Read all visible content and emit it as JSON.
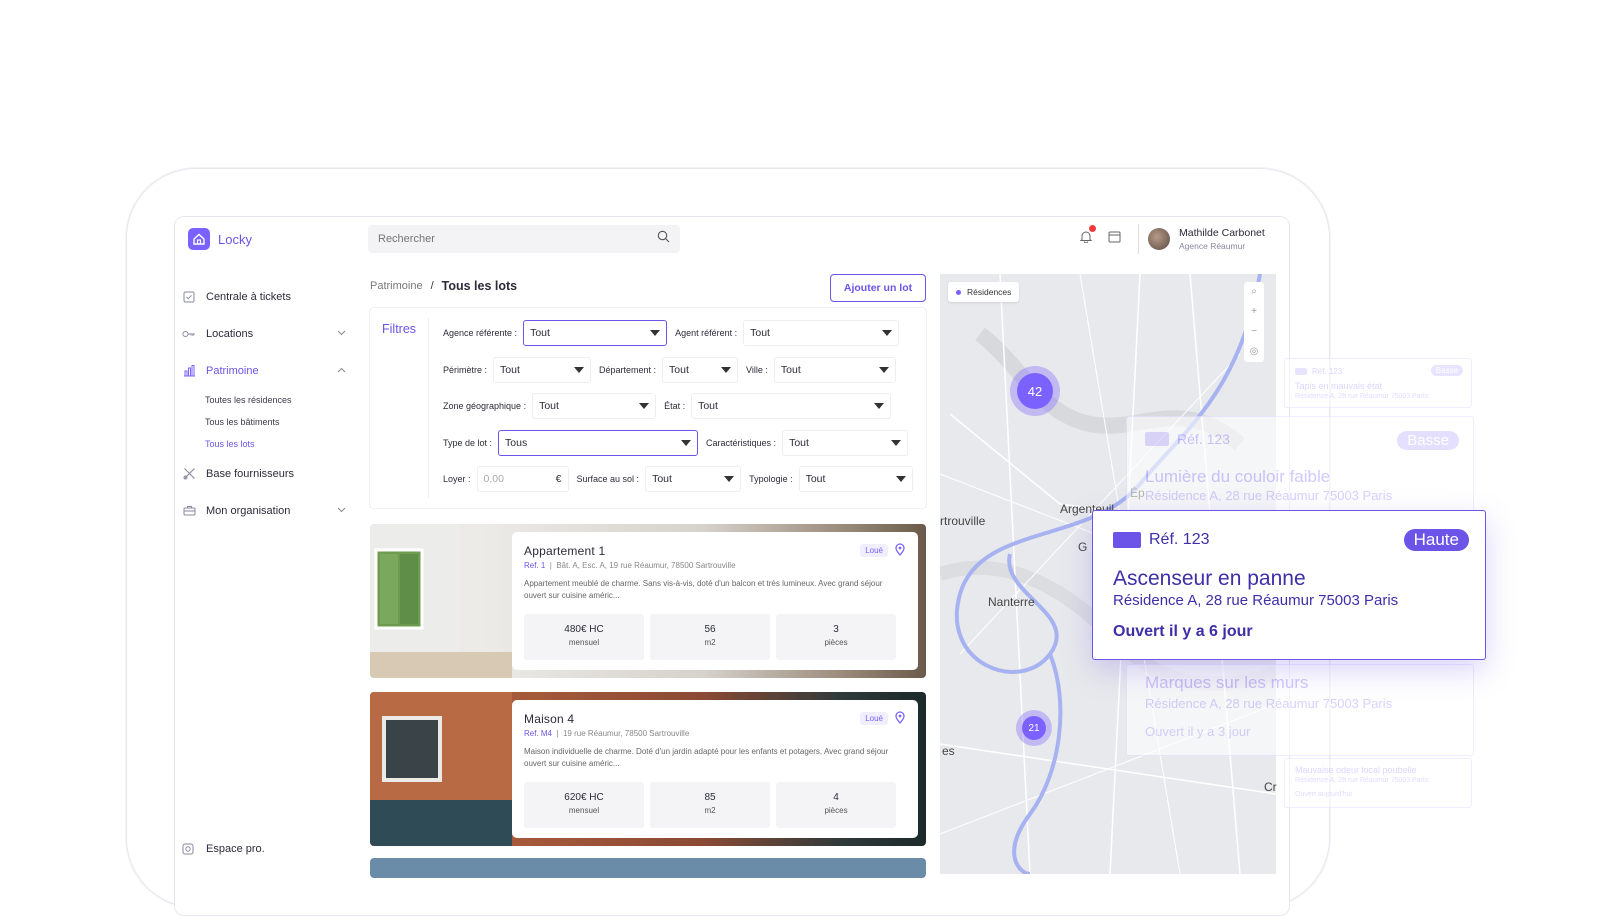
{
  "app": {
    "name": "Locky"
  },
  "search": {
    "placeholder": "Rechercher"
  },
  "user": {
    "name": "Mathilde Carbonet",
    "agency": "Agence Réaumur"
  },
  "sidebar": {
    "items": [
      {
        "label": "Centrale à tickets",
        "icon": "ticket-check-icon"
      },
      {
        "label": "Locations",
        "icon": "key-icon"
      },
      {
        "label": "Patrimoine",
        "icon": "building-chart-icon"
      },
      {
        "label": "Base fournisseurs",
        "icon": "tools-icon"
      },
      {
        "label": "Mon organisation",
        "icon": "briefcase-icon"
      }
    ],
    "sub_items": [
      "Toutes les résidences",
      "Tous les bâtiments",
      "Tous les lots"
    ],
    "footer": "Espace pro."
  },
  "breadcrumb": {
    "parent": "Patrimoine",
    "sep": "/",
    "current": "Tous les lots"
  },
  "actions": {
    "add_lot": "Ajouter un lot"
  },
  "filters": {
    "title": "Filtres",
    "agence_label": "Agence référente :",
    "agence_value": "Tout",
    "agent_label": "Agent référent :",
    "agent_value": "Tout",
    "perimetre_label": "Périmètre :",
    "perimetre_value": "Tout",
    "departement_label": "Département :",
    "departement_value": "Tout",
    "ville_label": "Ville :",
    "ville_value": "Tout",
    "zone_label": "Zone géographique :",
    "zone_value": "Tout",
    "etat_label": "État :",
    "etat_value": "Tout",
    "type_label": "Type de lot :",
    "type_value": "Tous",
    "carac_label": "Caractéristiques :",
    "carac_value": "Tout",
    "loyer_label": "Loyer :",
    "loyer_placeholder": "0,00",
    "loyer_unit": "€",
    "surface_label": "Surface au sol :",
    "surface_value": "Tout",
    "typologie_label": "Typologie :",
    "typologie_value": "Tout"
  },
  "lots": [
    {
      "title": "Appartement 1",
      "ref": "Ref. 1",
      "address": "Bât. A, Esc. A, 19 rue Réaumur, 78500 Sartrouville",
      "status": "Loué",
      "desc": "Appartement meublé de charme. Sans vis-à-vis, doté d'un balcon et très lumineux. Avec grand séjour ouvert sur cuisine améric...",
      "rent": "480€ HC",
      "rent_label": "mensuel",
      "surface": "56",
      "surface_label": "m2",
      "rooms": "3",
      "rooms_label": "pièces"
    },
    {
      "title": "Maison 4",
      "ref": "Ref. M4",
      "address": "19 rue Réaumur, 78500 Sartrouville",
      "status": "Loué",
      "desc": "Maison individuelle de charme. Doté d'un jardin adapté pour les enfants et potagers. Avec grand séjour ouvert sur cuisine améric...",
      "rent": "620€ HC",
      "rent_label": "mensuel",
      "surface": "85",
      "surface_label": "m2",
      "rooms": "4",
      "rooms_label": "pièces"
    }
  ],
  "map": {
    "chip": "Résidences",
    "clusters": [
      "42",
      "21"
    ],
    "labels": [
      "Argenteuil",
      "rtrouville",
      "Nanterre",
      "Ép",
      "G",
      "es",
      "Cr"
    ],
    "controls": [
      "⌕",
      "+",
      "−",
      "◎"
    ]
  },
  "tickets": [
    {
      "ref": "Réf.  123",
      "priority": "Basse",
      "title": "Tapis en mauvais état",
      "address": "Résidence A, 28 rue Réaumur 75003 Paris"
    },
    {
      "ref": "Réf.  123",
      "priority": "Basse",
      "title": "Lumière du couloir faible",
      "address": "Résidence A, 28 rue Réaumur 75003 Paris"
    },
    {
      "ref": "Réf.  123",
      "priority": "Haute",
      "title": "Ascenseur en panne",
      "address": "Résidence A, 28 rue Réaumur 75003 Paris",
      "opened": "Ouvert il y a 6 jour"
    },
    {
      "title": "Marques sur les murs",
      "address": "Résidence A, 28 rue Réaumur 75003 Paris",
      "opened": "Ouvert il y a 3 jour"
    },
    {
      "title": "Mauvaise odeur local poubelle",
      "address": "Résidence A, 28 rue Réaumur 75003 Paris",
      "opened": "Ouvert aujourd'hui"
    }
  ],
  "colors": {
    "accent": "#6c54e8",
    "accent_light": "#7b61ff",
    "alert": "#f03a3a"
  }
}
